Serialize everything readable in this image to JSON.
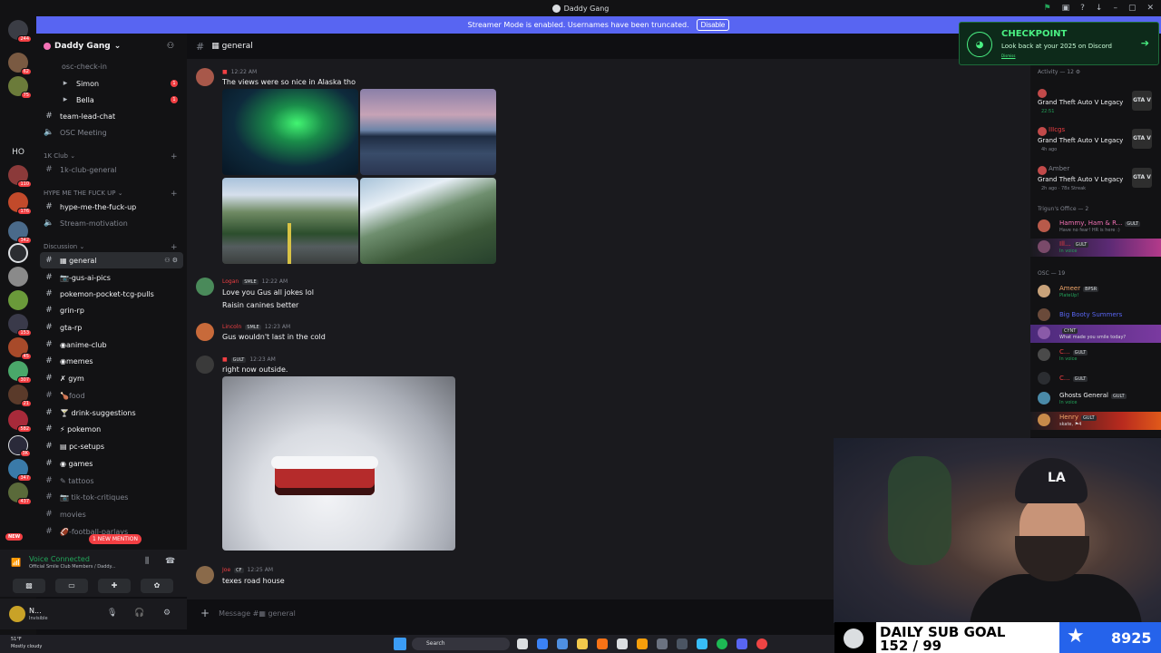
{
  "window": {
    "title": "Daddy Gang",
    "controls": [
      "⚑",
      "▣",
      "?",
      "↓",
      "–",
      "▢",
      "✕"
    ]
  },
  "streamer": {
    "text": "Streamer Mode is enabled. Usernames have been truncated.",
    "button": "Disable"
  },
  "servers": {
    "badges": [
      "244",
      "62",
      "75",
      "110",
      "176",
      "342",
      "153",
      "45",
      "307",
      "21",
      "582",
      "3K",
      "347",
      "437"
    ],
    "home_text": "HO",
    "new_label": "NEW"
  },
  "sidebar": {
    "server_name": "Daddy Gang",
    "channels": [
      {
        "label": "osc-check-in",
        "bright": false,
        "sub": false
      },
      {
        "label": "Simon",
        "bright": true,
        "sub": true,
        "unread": "1"
      },
      {
        "label": "Bella",
        "bright": true,
        "sub": true,
        "unread": "1"
      },
      {
        "label": "team-lead-chat",
        "bright": true,
        "sub": false
      },
      {
        "label": "OSC Meeting",
        "bright": false,
        "sub": false
      }
    ],
    "cat_1k": "1K Club",
    "ch_1k": "1k-club-general",
    "cat_hype": "HYPE ME THE FUCK UP",
    "ch_hype": "hype-me-the-fuck-up",
    "ch_stream": "Stream-motivation",
    "cat_discussion": "Discussion",
    "discussion_channels": [
      {
        "label": "▦ general",
        "bright": true,
        "active": true
      },
      {
        "label": "📷-gus-ai-pics",
        "bright": true
      },
      {
        "label": "pokemon-pocket-tcg-pulls",
        "bright": true
      },
      {
        "label": "grin-rp",
        "bright": true
      },
      {
        "label": "gta-rp",
        "bright": true
      },
      {
        "label": "◉anime-club",
        "bright": true
      },
      {
        "label": "◉memes",
        "bright": true
      },
      {
        "label": "✗ gym",
        "bright": true
      },
      {
        "label": "🍗food",
        "bright": false
      },
      {
        "label": "🍸 drink-suggestions",
        "bright": true
      },
      {
        "label": "⚡ pokemon",
        "bright": true
      },
      {
        "label": "▤ pc-setups",
        "bright": true
      },
      {
        "label": "◉ games",
        "bright": true
      },
      {
        "label": "✎ tattoos",
        "bright": false
      },
      {
        "label": "📷 tik-tok-critiques",
        "bright": false
      },
      {
        "label": "movies",
        "bright": false
      },
      {
        "label": "🏈-football-parlays",
        "bright": false
      }
    ],
    "mention": "1 NEW MENTION"
  },
  "voice": {
    "status": "Voice Connected",
    "channel": "Official Smile Club Members / Daddy..."
  },
  "user": {
    "name": "N...",
    "status": "Invisible"
  },
  "chat": {
    "channel": "▦ general",
    "messages": [
      {
        "time": "12:22 AM",
        "text": "The views were so nice in Alaska tho"
      },
      {
        "user": "Logan",
        "tag": "SMLE",
        "time": "12:22 AM",
        "lines": [
          "Love you Gus all jokes lol",
          "Raisin canines better"
        ]
      },
      {
        "user": "Lincoln",
        "tag": "SMLE",
        "time": "12:23 AM",
        "text": "Gus wouldn't last in the cold"
      },
      {
        "tag": "GULT",
        "time": "12:23 AM",
        "text": "right now outside."
      },
      {
        "user": "Joe",
        "tag": "CF",
        "time": "12:25 AM",
        "text": "texes road house"
      }
    ],
    "composer_placeholder": "Message #▦ general"
  },
  "checkpoint": {
    "title": "CHECKPOINT",
    "subtitle": "Look back at your 2025 on Discord",
    "dismiss": "Dismiss"
  },
  "members": {
    "activity_header": "Activity — 12 ⚙",
    "activity": [
      {
        "name": "",
        "game": "Grand Theft Auto V Legacy",
        "sub": "22:51"
      },
      {
        "name": "IIIcgs",
        "game": "Grand Theft Auto V Legacy",
        "sub": "4h ago"
      },
      {
        "name": "Amber",
        "game": "Grand Theft Auto V Legacy",
        "sub": "2h ago  ·  78x Streak"
      }
    ],
    "game_icon": "GTA V",
    "trigun_header": "Trigun's Office — 2",
    "trigun": [
      {
        "name": "Hammy, Ham & R...",
        "tag": "GULT",
        "sub": "Have no fear! HR is here :)"
      },
      {
        "name": "Ill...",
        "tag": "GULT",
        "sub": "In voice"
      }
    ],
    "osc_header": "OSC — 19",
    "osc": [
      {
        "name": "Ameer",
        "tag": "BPSR",
        "sub": "PlateUp!"
      },
      {
        "name": "Big Booty Summers",
        "tag": "",
        "sub": ""
      },
      {
        "name": "",
        "tag": "CYNT",
        "sub": "What made you smile today?"
      },
      {
        "name": "C...",
        "tag": "GULT",
        "sub": "In voice"
      },
      {
        "name": "C...",
        "tag": "GULT",
        "sub": ""
      },
      {
        "name": "Ghosts General",
        "tag": "GULT",
        "sub": "In voice"
      },
      {
        "name": "Henry",
        "tag": "GULT",
        "sub": "skate, ⚑4"
      }
    ]
  },
  "subgoal": {
    "label": "DAILY SUB GOAL",
    "count": "152 / 99",
    "total": "8925"
  },
  "taskbar": {
    "weather_temp": "51°F",
    "weather_desc": "Mostly cloudy",
    "search": "Search"
  },
  "colors": {
    "blurple": "#5865f2",
    "green": "#23a55a",
    "red": "#f23f43",
    "checkpoint_green": "#4af083"
  }
}
